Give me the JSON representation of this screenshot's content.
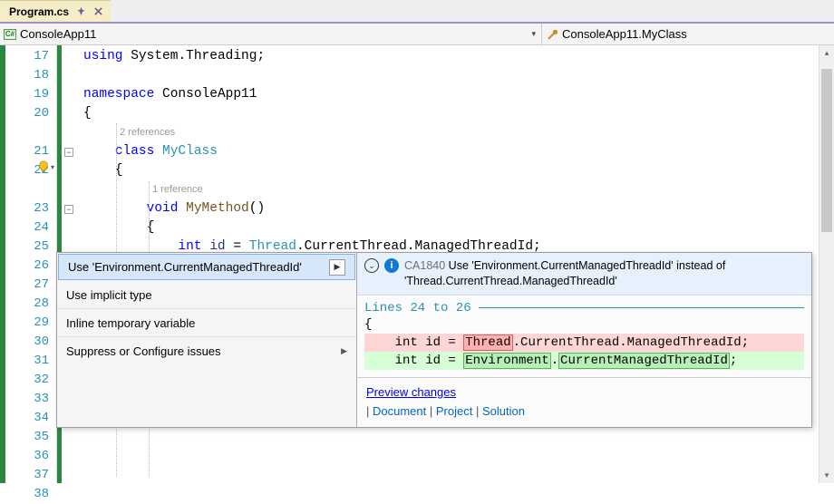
{
  "tab": {
    "filename": "Program.cs"
  },
  "nav": {
    "left": "ConsoleApp11",
    "right": "ConsoleApp11.MyClass",
    "left_icon": "C#"
  },
  "gutter": {
    "start": 17,
    "end": 38
  },
  "code_lens": {
    "class_refs": "2 references",
    "method_refs": "1 reference"
  },
  "code": {
    "17": [
      [
        "kw",
        "using"
      ],
      [
        "pn",
        " System"
      ],
      [
        "pn",
        "."
      ],
      [
        "pn",
        "Threading"
      ],
      [
        "pn",
        ";"
      ]
    ],
    "18": [],
    "19": [
      [
        "kw",
        "namespace"
      ],
      [
        "pn",
        " "
      ],
      [
        "pn",
        "ConsoleApp11"
      ]
    ],
    "20": [
      [
        "pn",
        "{"
      ]
    ],
    "21": [
      [
        "pn",
        "    "
      ],
      [
        "kw",
        "class"
      ],
      [
        "pn",
        " "
      ],
      [
        "ty",
        "MyClass"
      ]
    ],
    "22": [
      [
        "pn",
        "    {"
      ]
    ],
    "23": [
      [
        "pn",
        "        "
      ],
      [
        "kw",
        "void"
      ],
      [
        "pn",
        " "
      ],
      [
        "me",
        "MyMethod"
      ],
      [
        "pn",
        "()"
      ]
    ],
    "24": [
      [
        "pn",
        "        {"
      ]
    ],
    "25": [
      [
        "pn",
        "            "
      ],
      [
        "kw",
        "int"
      ],
      [
        "pn",
        " "
      ],
      [
        "id",
        "id"
      ],
      [
        "pn",
        " = "
      ],
      [
        "ty",
        "Thread"
      ],
      [
        "pn",
        "."
      ],
      [
        "pn",
        "CurrentThread"
      ],
      [
        "pn",
        "."
      ],
      [
        "pn",
        "ManagedThreadId"
      ],
      [
        "pn",
        ";"
      ]
    ]
  },
  "menu": {
    "items": [
      {
        "label": "Use 'Environment.CurrentManagedThreadId'",
        "selected": true,
        "expand": true
      },
      {
        "label": "Use implicit type"
      },
      {
        "label": "Inline temporary variable"
      },
      {
        "label": "Suppress or Configure issues",
        "submenu": true
      }
    ]
  },
  "preview": {
    "code_id": "CA1840",
    "message": "Use 'Environment.CurrentManagedThreadId' instead of 'Thread.CurrentThread.ManagedThreadId'",
    "range": "Lines 24 to 26",
    "brace_open": "{",
    "diff": {
      "prefix": "    int id = ",
      "old_token": "Thread",
      "old_rest": ".CurrentThread.ManagedThreadId",
      "new_token": "Environment",
      "new_rest_a": ".",
      "new_rest_b": "CurrentManagedThreadId",
      "semicolon": ";"
    },
    "footer": {
      "preview_link": "Preview changes",
      "scope_label_document": "Document",
      "scope_label_project": "Project",
      "scope_label_solution": "Solution",
      "sep": " | "
    }
  }
}
